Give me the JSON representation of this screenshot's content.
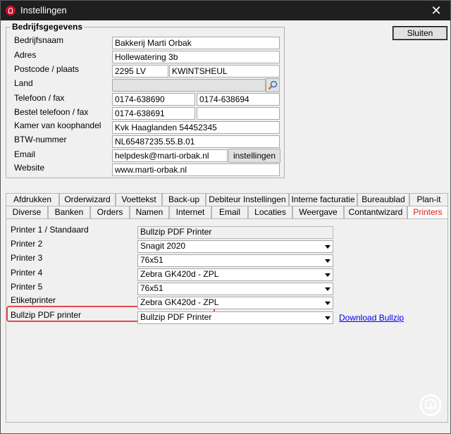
{
  "window": {
    "title": "Instellingen",
    "close_glyph": "✕"
  },
  "buttons": {
    "sluiten": "Sluiten",
    "instellingen": "instellingen"
  },
  "bedrijf": {
    "title": "Bedrijfsgegevens",
    "labels": {
      "bedrijfsnaam": "Bedrijfsnaam",
      "adres": "Adres",
      "postcode": "Postcode / plaats",
      "land": "Land",
      "telefoon": "Telefoon / fax",
      "bestel": "Bestel telefoon / fax",
      "kvk": "Kamer van koophandel",
      "btw": "BTW-nummer",
      "email": "Email",
      "website": "Website"
    },
    "values": {
      "bedrijfsnaam": "Bakkerij Marti Orbak",
      "adres": "Hollewatering 3b",
      "postcode": "2295 LV",
      "plaats": "KWINTSHEUL",
      "land": "",
      "telefoon": "0174-638690",
      "fax": "0174-638694",
      "bestel_telefoon": "0174-638691",
      "bestel_fax": "",
      "kvk": "Kvk Haaglanden 54452345",
      "btw": "NL65487235.55.B.01",
      "email": "helpdesk@marti-orbak.nl",
      "website": "www.marti-orbak.nl"
    }
  },
  "tabs_row1": [
    "Afdrukken",
    "Orderwizard",
    "Voettekst",
    "Back-up",
    "Debiteur Instellingen",
    "Interne facturatie",
    "Bureaublad",
    "Plan-it"
  ],
  "tabs_row2": [
    "Diverse",
    "Banken",
    "Orders",
    "Namen",
    "Internet",
    "Email",
    "Locaties",
    "Weergave",
    "Contantwizard",
    "Printers"
  ],
  "active_tab": "Printers",
  "printers": {
    "labels": [
      "Printer 1 / Standaard",
      "Printer 2",
      "Printer 3",
      "Printer 4",
      "Printer 5",
      "Etiketprinter",
      "Bullzip PDF printer"
    ],
    "values": [
      "Bullzip PDF Printer",
      "Snagit 2020",
      "76x51",
      "Zebra GK420d - ZPL",
      "76x51",
      "Zebra GK420d - ZPL",
      "Bullzip PDF Printer"
    ],
    "download_link": "Download Bullzip"
  },
  "colors": {
    "active_tab_text": "#e02020",
    "highlight": "#e5484d",
    "link": "#0000ee"
  }
}
